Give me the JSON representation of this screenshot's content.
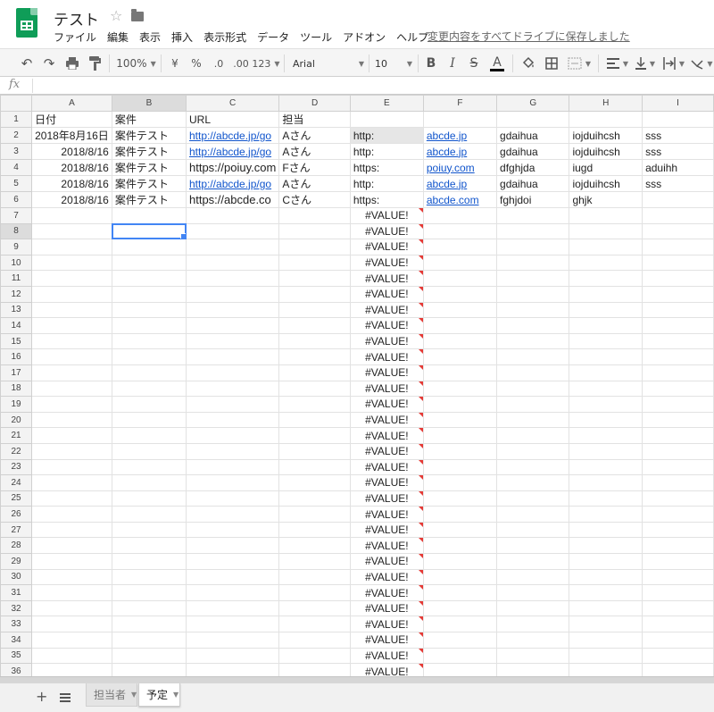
{
  "app": {
    "title": "テスト",
    "save_status": "変更内容をすべてドライブに保存しました",
    "menu": [
      "ファイル",
      "編集",
      "表示",
      "挿入",
      "表示形式",
      "データ",
      "ツール",
      "アドオン",
      "ヘルプ"
    ]
  },
  "toolbar": {
    "zoom": "100%",
    "currency": "¥",
    "percent": "%",
    "dec_decrease": ".0",
    "dec_increase": ".00",
    "more_formats": "123",
    "font": "Arial",
    "font_size": "10",
    "bold": "B",
    "italic": "I",
    "strike": "S",
    "text_color": "A",
    "text_color_accent": "#000000"
  },
  "formula_bar": {
    "label": "fx",
    "value": ""
  },
  "grid": {
    "columns": [
      "A",
      "B",
      "C",
      "D",
      "E",
      "F",
      "G",
      "H",
      "I"
    ],
    "row_numbers": [
      "1",
      "2",
      "3",
      "4",
      "5",
      "6",
      "7",
      "8",
      "9",
      "10",
      "11",
      "12",
      "13",
      "14",
      "15",
      "16",
      "17",
      "18",
      "19",
      "20",
      "21",
      "22",
      "23",
      "24",
      "25",
      "26",
      "27",
      "28",
      "29",
      "30",
      "31",
      "32",
      "33",
      "34",
      "35",
      "36"
    ],
    "selected_column": "B",
    "selected_row": "8",
    "rows": [
      [
        "日付",
        "案件",
        "URL",
        "担当",
        "",
        "",
        "",
        "",
        ""
      ],
      [
        "2018年8月16日",
        "案件テスト",
        "http://abcde.jp/go",
        "Aさん",
        "http:",
        "abcde.jp",
        "gdaihua",
        "iojduihcsh",
        "sss"
      ],
      [
        "2018/8/16",
        "案件テスト",
        "http://abcde.jp/go",
        "Aさん",
        "http:",
        "abcde.jp",
        "gdaihua",
        "iojduihcsh",
        "sss"
      ],
      [
        "2018/8/16",
        "案件テスト",
        "https://poiuy.com",
        "Fさん",
        "https:",
        "poiuy.com",
        "dfghjda",
        "iugd",
        "aduihh"
      ],
      [
        "2018/8/16",
        "案件テスト",
        "http://abcde.jp/go",
        "Aさん",
        "http:",
        "abcde.jp",
        "gdaihua",
        "iojduihcsh",
        "sss"
      ],
      [
        "2018/8/16",
        "案件テスト",
        "https://abcde.co",
        "Cさん",
        "https:",
        "abcde.com",
        "fghjdoi",
        "ghjk",
        ""
      ]
    ],
    "error_value": "#VALUE!"
  },
  "sheets": [
    {
      "name": "担当者",
      "active": false
    },
    {
      "name": "予定",
      "active": true
    }
  ]
}
